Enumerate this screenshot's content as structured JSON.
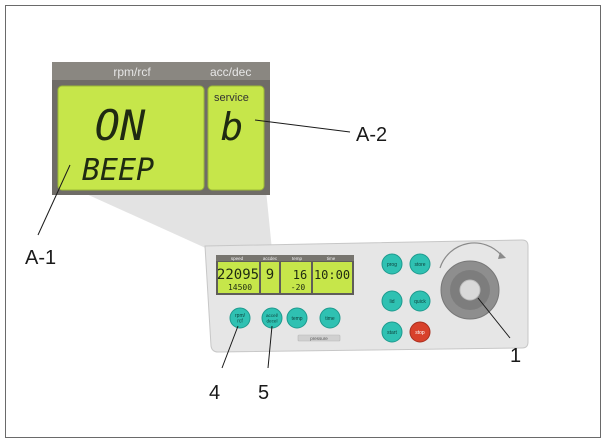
{
  "zoom_display": {
    "headers": {
      "left": "rpm/rcf",
      "right": "acc/dec"
    },
    "left_lcd": {
      "line1": "ON",
      "line2": "BEEP"
    },
    "right_lcd": {
      "label": "service",
      "value": "b"
    }
  },
  "panel": {
    "lcd_headers": [
      "speed",
      "accdec",
      "temp",
      "time"
    ],
    "lcd_values": {
      "speed_top": "22095",
      "speed_bottom": "14500",
      "accdec_top": "9",
      "accdec_bottom": "",
      "temp_top": "16",
      "temp_bottom": "-20",
      "time_top": "10:00"
    },
    "buttons": {
      "rpm_rcf": "rpm/ rcf",
      "accel_decel": "accel/ decel",
      "temp": "temp",
      "time": "time",
      "prog": "prog",
      "store": "store",
      "lid": "lid",
      "quick": "quick",
      "start": "start",
      "stop": "stop"
    },
    "pressure_label": "pressure"
  },
  "callouts": {
    "a1": "A-1",
    "a2": "A-2",
    "knob": "1",
    "rpm": "4",
    "accel": "5"
  },
  "colors": {
    "lcd_green": "#c6e64a",
    "button_teal": "#2fc1b2",
    "stop_red": "#d8412b",
    "panel_gray": "#e4e4e4"
  }
}
